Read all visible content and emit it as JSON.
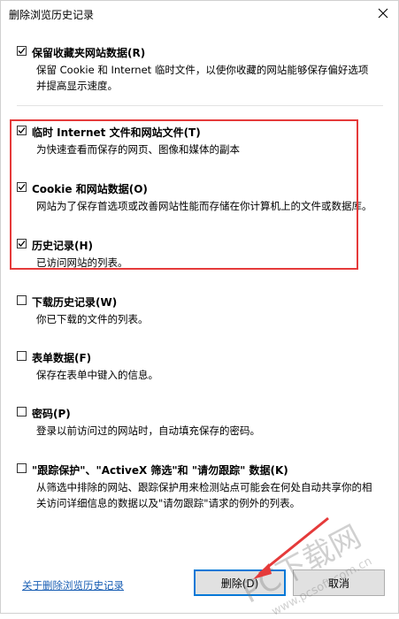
{
  "window": {
    "title": "删除浏览历史记录"
  },
  "options": [
    {
      "label": "保留收藏夹网站数据(R)",
      "desc": "保留 Cookie 和 Internet 临时文件，以使你收藏的网站能够保存偏好选项并提高显示速度。",
      "checked": true
    },
    {
      "label": "临时 Internet 文件和网站文件(T)",
      "desc": "为快速查看而保存的网页、图像和媒体的副本",
      "checked": true
    },
    {
      "label": "Cookie 和网站数据(O)",
      "desc": "网站为了保存首选项或改善网站性能而存储在你计算机上的文件或数据库。",
      "checked": true
    },
    {
      "label": "历史记录(H)",
      "desc": "已访问网站的列表。",
      "checked": true
    },
    {
      "label": "下载历史记录(W)",
      "desc": "你已下载的文件的列表。",
      "checked": false
    },
    {
      "label": "表单数据(F)",
      "desc": "保存在表单中键入的信息。",
      "checked": false
    },
    {
      "label": "密码(P)",
      "desc": "登录以前访问过的网站时，自动填充保存的密码。",
      "checked": false
    },
    {
      "label": "\"跟踪保护\"、\"ActiveX 筛选\"和 \"请勿跟踪\" 数据(K)",
      "desc": "从筛选中排除的网站、跟踪保护用来检测站点可能会在何处自动共享你的相关访问详细信息的数据以及\"请勿跟踪\"请求的例外的列表。",
      "checked": false
    }
  ],
  "footer": {
    "link": "关于删除浏览历史记录",
    "delete_label": "删除(D)",
    "cancel_label": "取消"
  },
  "watermark": {
    "main": "PC下载网",
    "url": "www.pcsoft.com.cn"
  },
  "colors": {
    "highlight": "#e53a3a",
    "link": "#1a5fb4",
    "primary_border": "#0078d7"
  }
}
